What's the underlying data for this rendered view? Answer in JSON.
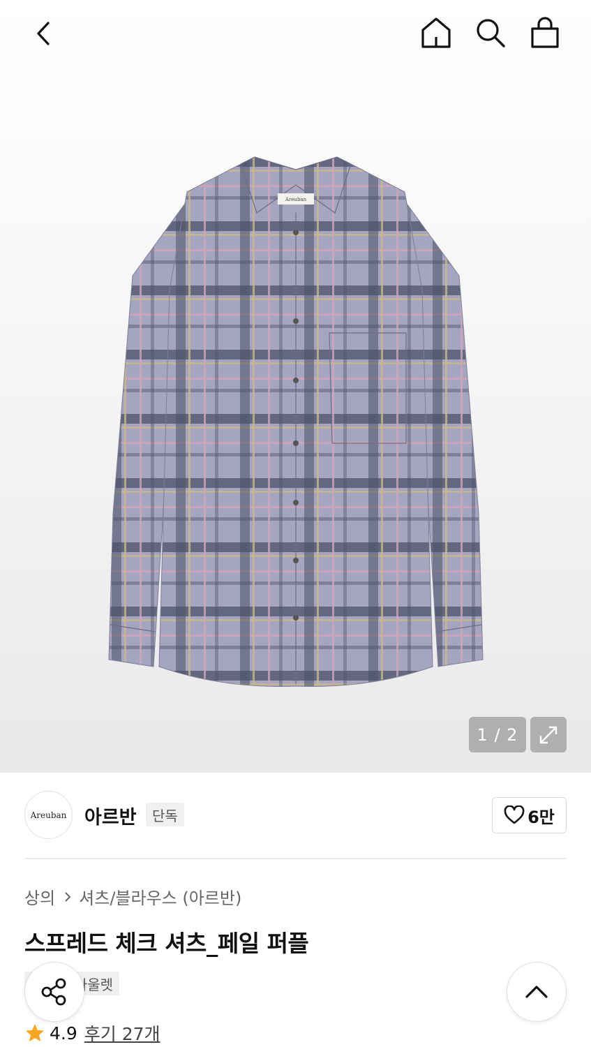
{
  "header": {
    "icons": [
      "chevron-left-icon",
      "home-icon",
      "search-icon",
      "shopping-bag-icon"
    ]
  },
  "product_image": {
    "shirt_label": "Areuban",
    "colors": {
      "base": "#a3a3c0",
      "dark_stripe": "#4a4f63",
      "accent_stripe": "#c9a8b8",
      "yellow_stripe": "#c8b98a"
    }
  },
  "gallery": {
    "counter": "1 / 2",
    "expand_icon": "expand-icon"
  },
  "brand": {
    "logo_text": "Areuban",
    "name": "아르반",
    "tag": "단독",
    "like_count": "6만",
    "like_icon": "heart-outline-icon"
  },
  "breadcrumb": {
    "level1": "상의",
    "level2": "셔츠/블라우스 (아르반)"
  },
  "product": {
    "title": "스프레드 체크 셔츠_페일 퍼플",
    "tags": [
      "단독",
      "아울렛"
    ]
  },
  "rating": {
    "score": "4.9",
    "review_link": "후기 27개",
    "star_color": "#f5a623"
  },
  "fab": {
    "share_icon": "share-icon",
    "top_icon": "chevron-up-icon"
  }
}
